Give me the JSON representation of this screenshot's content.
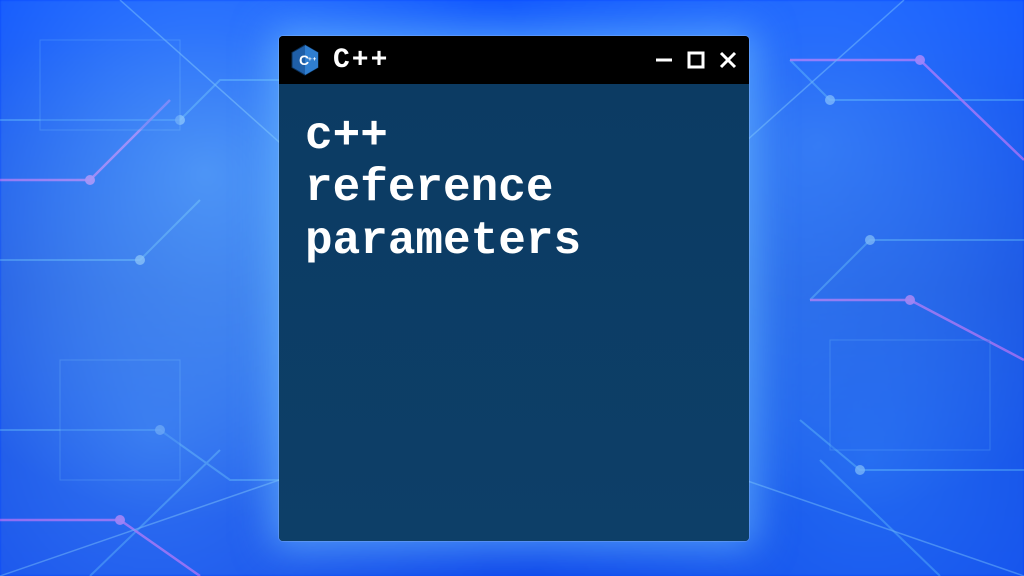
{
  "titlebar": {
    "app_title": "C++",
    "icon_name": "cpp-icon"
  },
  "content": {
    "text": "c++\nreference\nparameters"
  },
  "colors": {
    "titlebar_bg": "#000000",
    "window_bg": "#0b3b63",
    "text": "#ffffff",
    "glow": "#78c8ff"
  }
}
